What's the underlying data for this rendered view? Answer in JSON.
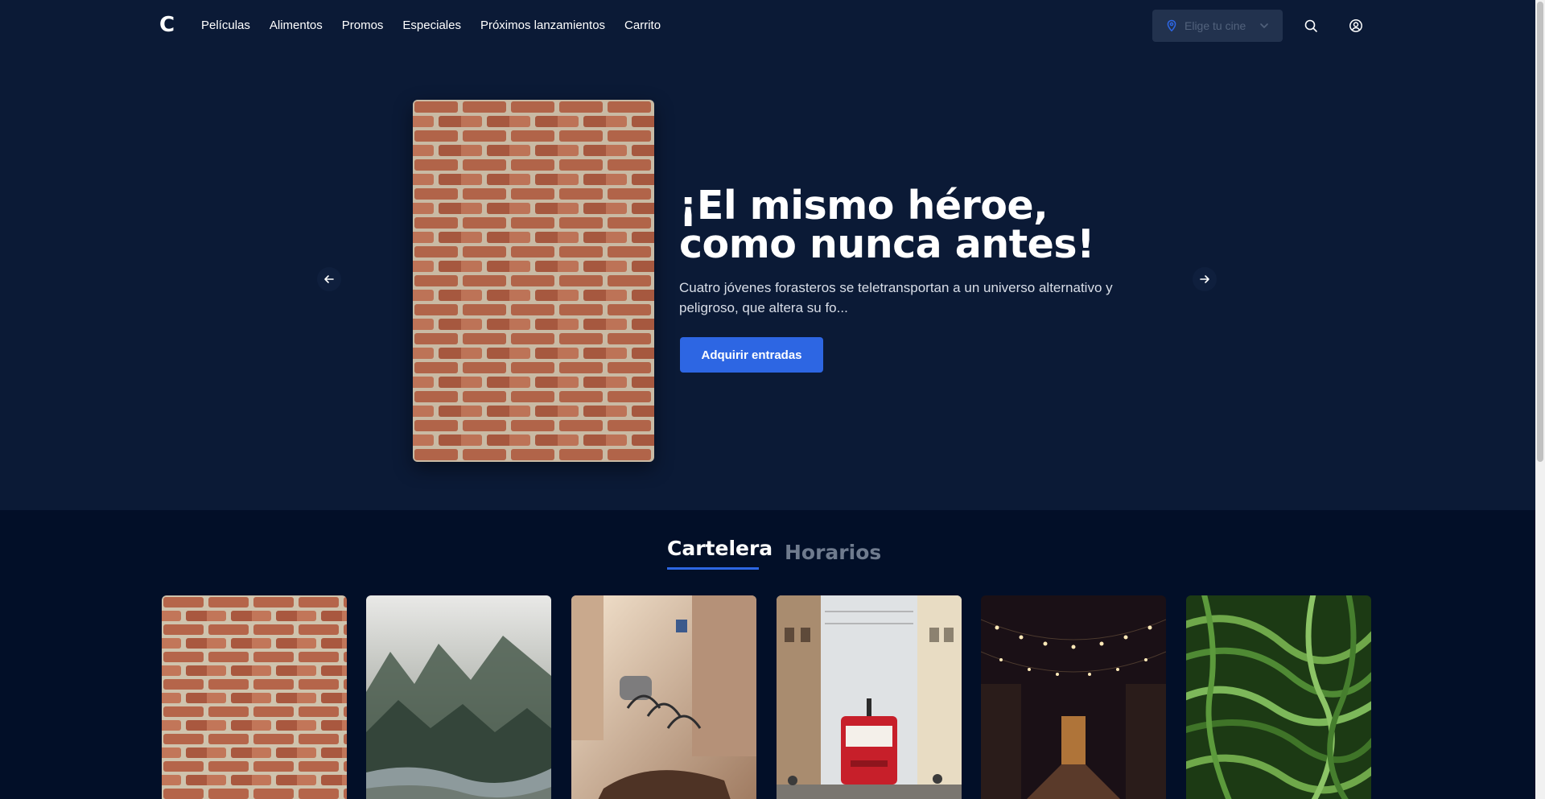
{
  "header": {
    "logo": "C",
    "nav": [
      "Películas",
      "Alimentos",
      "Promos",
      "Especiales",
      "Próximos lanzamientos",
      "Carrito"
    ],
    "cinema_select_placeholder": "Elige tu cine"
  },
  "hero": {
    "title": "¡El mismo héroe, como nunca antes!",
    "description": "Cuatro jóvenes forasteros se teletransportan a un universo alternativo y peligroso, que altera su fo...",
    "cta": "Adquirir entradas"
  },
  "tabs": {
    "cartelera": "Cartelera",
    "horarios": "Horarios"
  },
  "movies": [
    {
      "image": "brick-wall"
    },
    {
      "image": "misty-forest-river"
    },
    {
      "image": "street-bicycles"
    },
    {
      "image": "red-tram-street"
    },
    {
      "image": "string-lights-alley"
    },
    {
      "image": "green-beans"
    }
  ],
  "colors": {
    "background": "#0b1a36",
    "lower_background": "#020f28",
    "accent": "#2d66e3",
    "select_bg": "#22324e"
  },
  "icons": {
    "location": "location-pin-icon",
    "dropdown": "chevron-down-icon",
    "search": "search-icon",
    "user": "user-icon",
    "prev": "arrow-left-icon",
    "next": "arrow-right-icon"
  }
}
